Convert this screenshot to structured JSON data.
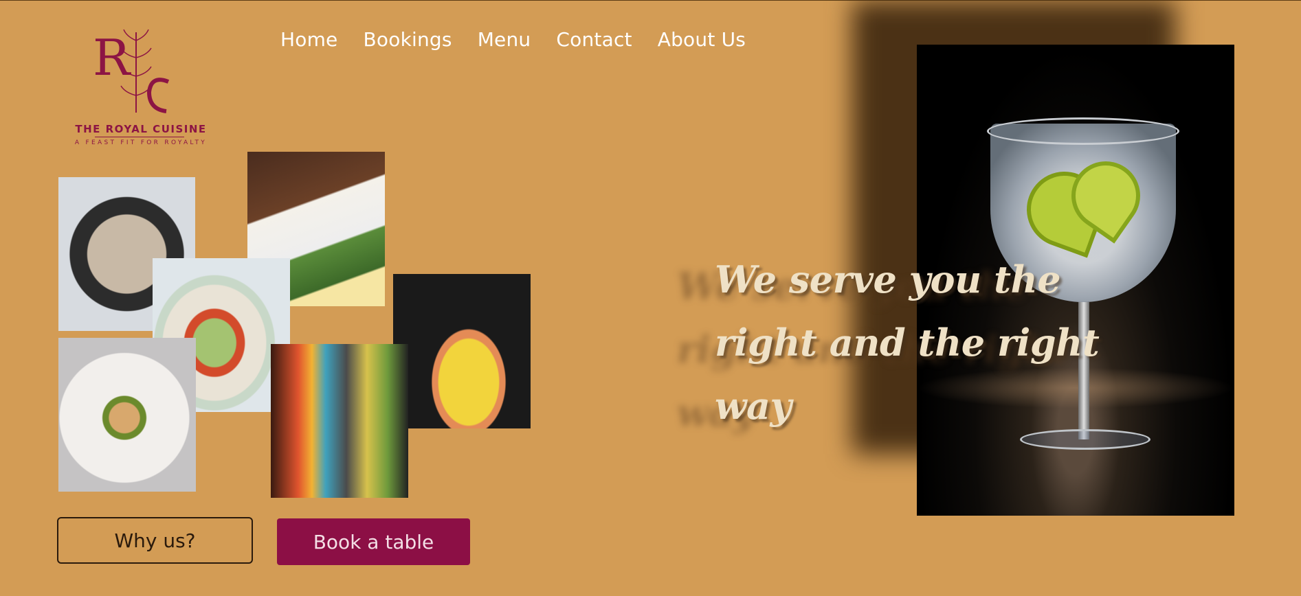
{
  "brand": {
    "monogram": "RC",
    "name": "THE ROYAL CUISINE",
    "tagline": "A FEAST FIT FOR ROYALTY",
    "color": "#8C1444"
  },
  "nav": {
    "items": [
      {
        "label": "Home"
      },
      {
        "label": "Bookings"
      },
      {
        "label": "Menu"
      },
      {
        "label": "Contact"
      },
      {
        "label": "About Us"
      }
    ]
  },
  "hero": {
    "line1": "We serve you the",
    "line2": "right and the right way"
  },
  "buttons": {
    "why_us": "Why us?",
    "book_table": "Book a table"
  },
  "theme": {
    "background": "#D39C55",
    "accent": "#8C0F45"
  }
}
